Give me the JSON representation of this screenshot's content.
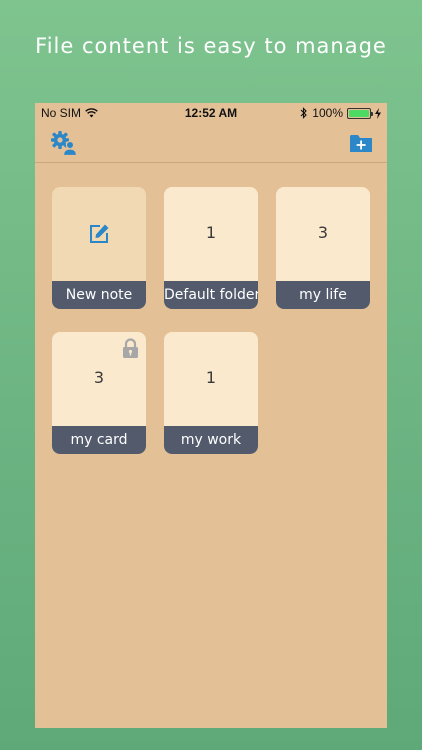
{
  "headline": "File content is easy to manage",
  "status_bar": {
    "carrier": "No SIM",
    "time": "12:52 AM",
    "battery_percent": "100%",
    "battery_level": 1.0,
    "icons": [
      "wifi-icon",
      "bluetooth-icon",
      "battery-icon",
      "charging-bolt-icon"
    ]
  },
  "navbar": {
    "left_icon": "settings-user-icon",
    "right_icon": "add-folder-icon"
  },
  "colors": {
    "background_top": "#7fc48f",
    "screen_background": "#e3c096",
    "card_background": "#fbe9cd",
    "label_bar": "#525a6c",
    "accent_blue": "#2c87c8"
  },
  "folders": [
    {
      "label": "New note",
      "count": "",
      "type": "new-note"
    },
    {
      "label": "Default folder",
      "count": "1",
      "type": "folder"
    },
    {
      "label": "my life",
      "count": "3",
      "type": "folder"
    },
    {
      "label": "my card",
      "count": "3",
      "type": "folder",
      "locked": true
    },
    {
      "label": "my work",
      "count": "1",
      "type": "folder"
    }
  ]
}
